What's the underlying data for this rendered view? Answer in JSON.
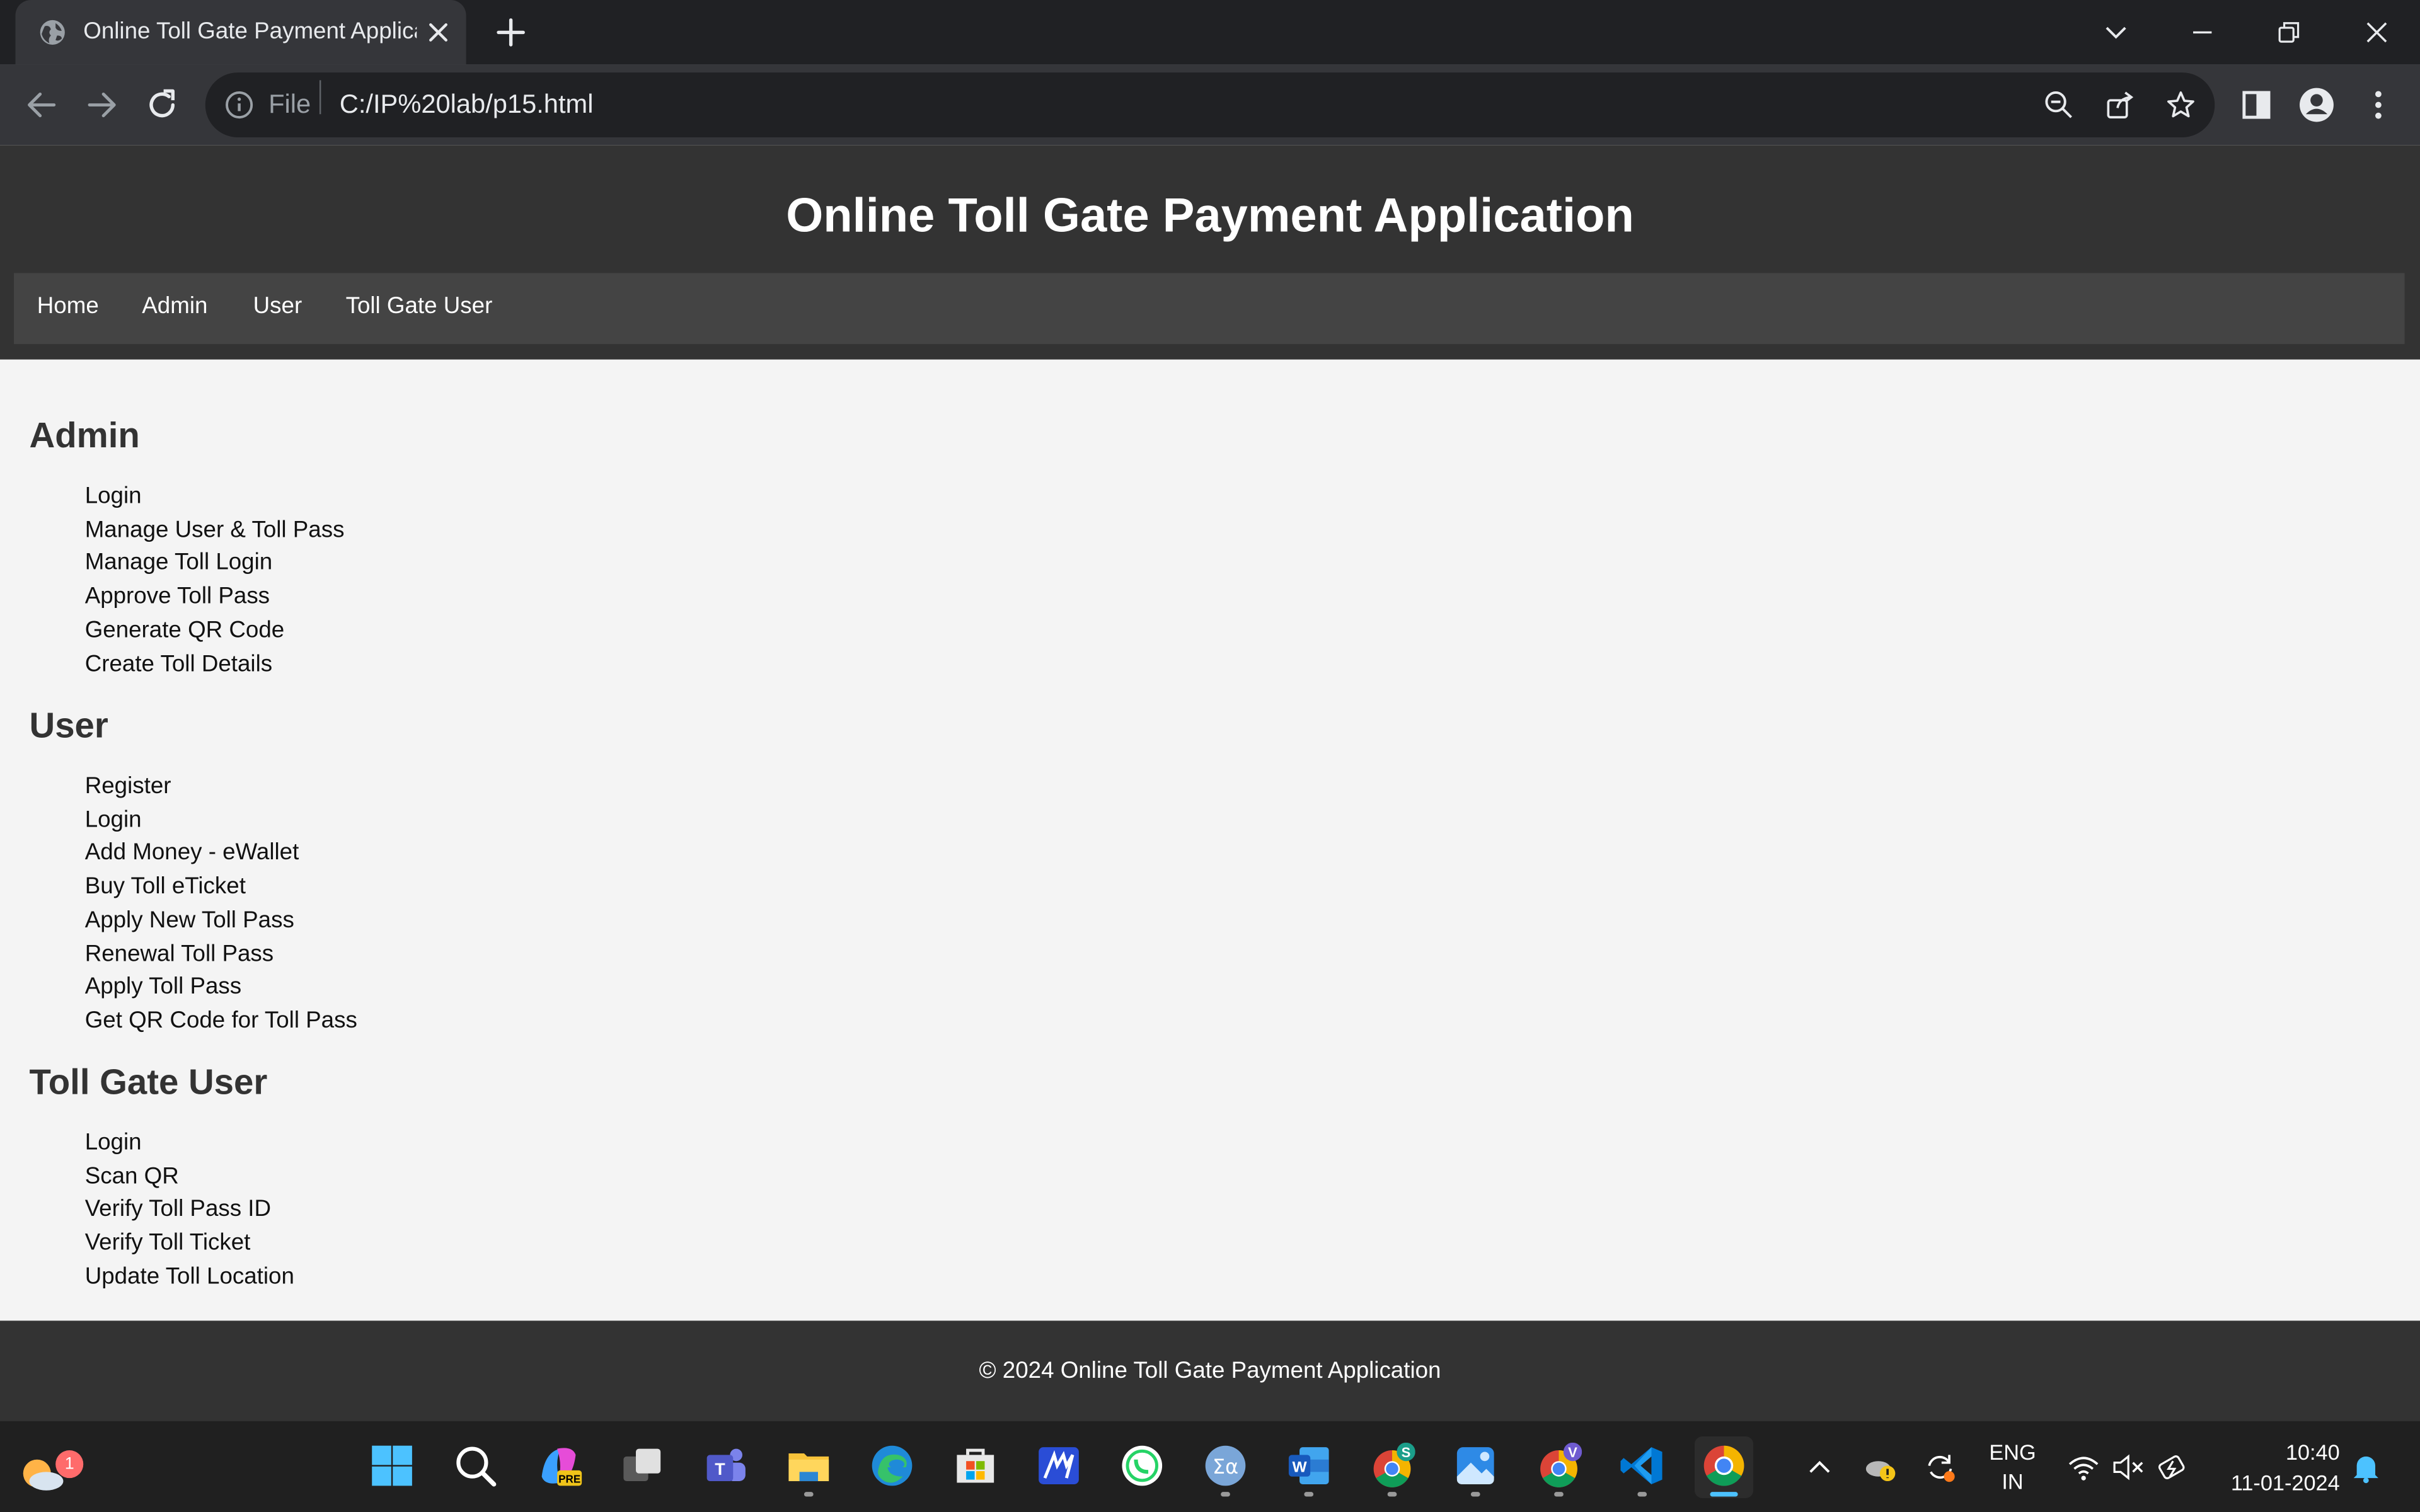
{
  "browser": {
    "tab_title": "Online Toll Gate Payment Application",
    "url_scheme": "File",
    "url": "C:/IP%20lab/p15.html"
  },
  "site": {
    "title": "Online Toll Gate Payment Application",
    "nav": [
      "Home",
      "Admin",
      "User",
      "Toll Gate User"
    ],
    "sections": [
      {
        "title": "Admin",
        "items": [
          "Login",
          "Manage User & Toll Pass",
          "Manage Toll Login",
          "Approve Toll Pass",
          "Generate QR Code",
          "Create Toll Details"
        ]
      },
      {
        "title": "User",
        "items": [
          "Register",
          "Login",
          "Add Money - eWallet",
          "Buy Toll eTicket",
          "Apply New Toll Pass",
          "Renewal Toll Pass",
          "Apply Toll Pass",
          "Get QR Code for Toll Pass"
        ]
      },
      {
        "title": "Toll Gate User",
        "items": [
          "Login",
          "Scan QR",
          "Verify Toll Pass ID",
          "Verify Toll Ticket",
          "Update Toll Location"
        ]
      }
    ],
    "footer": "© 2024 Online Toll Gate Payment Application"
  },
  "taskbar": {
    "weather_badge": "1",
    "copilot_badge": "PRE",
    "chrome_profile_s_badge": "S",
    "chrome_profile_v_badge": "V",
    "language": [
      "ENG",
      "IN"
    ],
    "time": "10:40",
    "date": "11-01-2024",
    "apps": [
      "start-icon",
      "search-icon",
      "copilot-icon",
      "task-view-icon",
      "teams-icon",
      "file-explorer-icon",
      "edge-icon",
      "store-icon",
      "maple-icon",
      "whatsapp-icon",
      "math-icon",
      "word-icon",
      "chrome-s-icon",
      "photos-icon",
      "chrome-v-icon",
      "vscode-icon",
      "chrome-icon"
    ]
  },
  "colors": {
    "header_bg": "#333333",
    "nav_bg": "#444444",
    "page_bg": "#f4f4f4",
    "browser_dark": "#202124",
    "browser_toolbar": "#35363a"
  }
}
